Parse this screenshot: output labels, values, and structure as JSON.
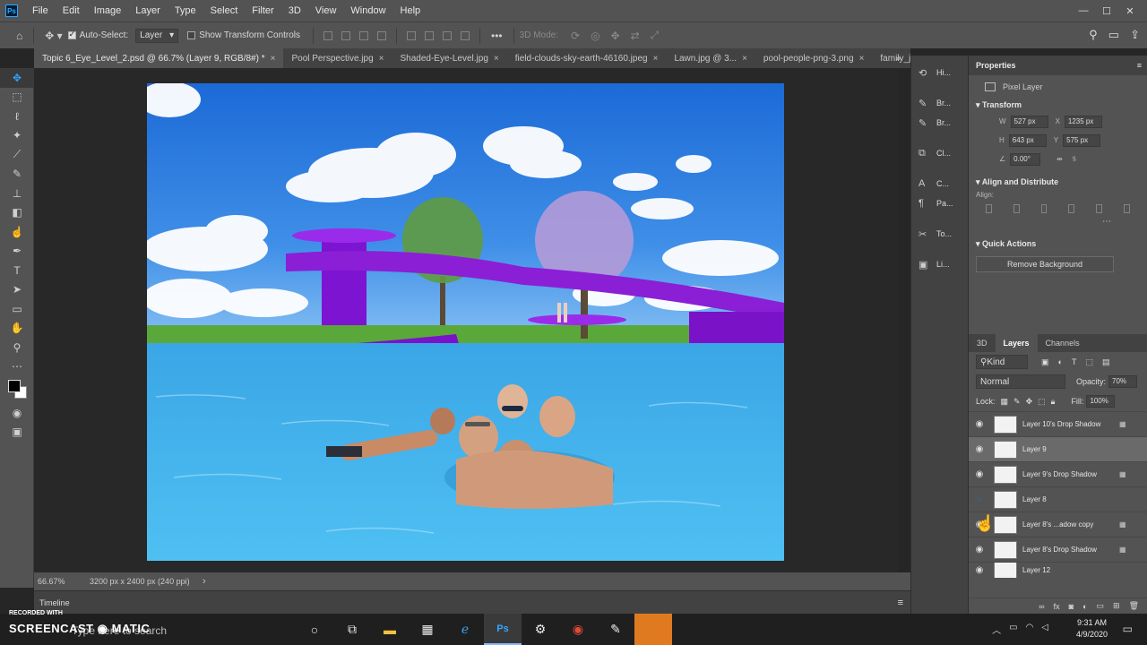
{
  "menubar": {
    "logo": "Ps",
    "items": [
      "File",
      "Edit",
      "Image",
      "Layer",
      "Type",
      "Select",
      "Filter",
      "3D",
      "View",
      "Window",
      "Help"
    ],
    "window_controls": [
      "—",
      "☐",
      "✕"
    ]
  },
  "options": {
    "auto_select_label": "Auto-Select:",
    "auto_select_value": "Layer",
    "show_transform_label": "Show Transform Controls",
    "mode_3d_label": "3D Mode:",
    "more": "•••"
  },
  "tabs": [
    {
      "label": "Topic 6_Eye_Level_2.psd @ 66.7% (Layer 9, RGB/8#) *",
      "close": "×"
    },
    {
      "label": "Pool Perspective.jpg",
      "close": "×"
    },
    {
      "label": "Shaded-Eye-Level.jpg",
      "close": "×"
    },
    {
      "label": "field-clouds-sky-earth-46160.jpeg",
      "close": "×"
    },
    {
      "label": "Lawn.jpg @ 3...",
      "close": "×"
    },
    {
      "label": "pool-people-png-3.png",
      "close": "×"
    },
    {
      "label": "family_j",
      "close": ""
    }
  ],
  "tabs_overflow": "»",
  "status": {
    "zoom": "66.67%",
    "doc_info": "3200 px x 2400 px (240 ppi)",
    "arrow": "›"
  },
  "timeline": {
    "label": "Timeline"
  },
  "mini_panels": [
    {
      "icon": "history-icon",
      "glyph": "⟲",
      "label": "Hi..."
    },
    {
      "icon": "brush-icon",
      "glyph": "✎",
      "label": "Br..."
    },
    {
      "icon": "brush-settings-icon",
      "glyph": "✎",
      "label": "Br..."
    },
    {
      "icon": "clone-icon",
      "glyph": "⧉",
      "label": "Cl..."
    },
    {
      "icon": "character-icon",
      "glyph": "A",
      "label": "C..."
    },
    {
      "icon": "paragraph-icon",
      "glyph": "¶",
      "label": "Pa..."
    },
    {
      "icon": "tool-presets-icon",
      "glyph": "✂",
      "label": "To..."
    },
    {
      "icon": "libraries-icon",
      "glyph": "▣",
      "label": "Li..."
    }
  ],
  "properties": {
    "title": "Properties",
    "layer_type": "Pixel Layer",
    "transform_title": "Transform",
    "w_label": "W",
    "w_value": "527 px",
    "x_label": "X",
    "x_value": "1235 px",
    "h_label": "H",
    "h_value": "643 px",
    "y_label": "Y",
    "y_value": "575 px",
    "angle_value": "0.00°",
    "align_title": "Align and Distribute",
    "align_label": "Align:",
    "quick_actions_title": "Quick Actions",
    "remove_bg_label": "Remove Background"
  },
  "layers_panel": {
    "tabs": [
      "3D",
      "Layers",
      "Channels"
    ],
    "active_tab": "Layers",
    "filter_label": "Kind",
    "blend_mode": "Normal",
    "opacity_label": "Opacity:",
    "opacity_value": "70%",
    "lock_label": "Lock:",
    "fill_label": "Fill:",
    "fill_value": "100%",
    "layers": [
      {
        "name": "Layer 10's Drop Shadow",
        "visible": true,
        "selected": false,
        "fx": true
      },
      {
        "name": "Layer 9",
        "visible": true,
        "selected": true,
        "fx": false
      },
      {
        "name": "Layer 9's Drop Shadow",
        "visible": true,
        "selected": false,
        "fx": true
      },
      {
        "name": "Layer 8",
        "visible": false,
        "selected": false,
        "fx": false
      },
      {
        "name": "Layer 8's ...adow copy",
        "visible": true,
        "selected": false,
        "fx": true
      },
      {
        "name": "Layer 8's Drop Shadow",
        "visible": true,
        "selected": false,
        "fx": true
      },
      {
        "name": "Layer 12",
        "visible": true,
        "selected": false,
        "fx": false
      }
    ]
  },
  "taskbar": {
    "watermark_small": "RECORDED WITH",
    "watermark_big": "SCREENCAST ◉ MATIC",
    "search_placeholder": "Type here to search",
    "time": "9:31 AM",
    "date": "4/9/2020"
  },
  "colors": {
    "accent": "#31a8ff",
    "panel": "#535353",
    "dark": "#282828"
  }
}
